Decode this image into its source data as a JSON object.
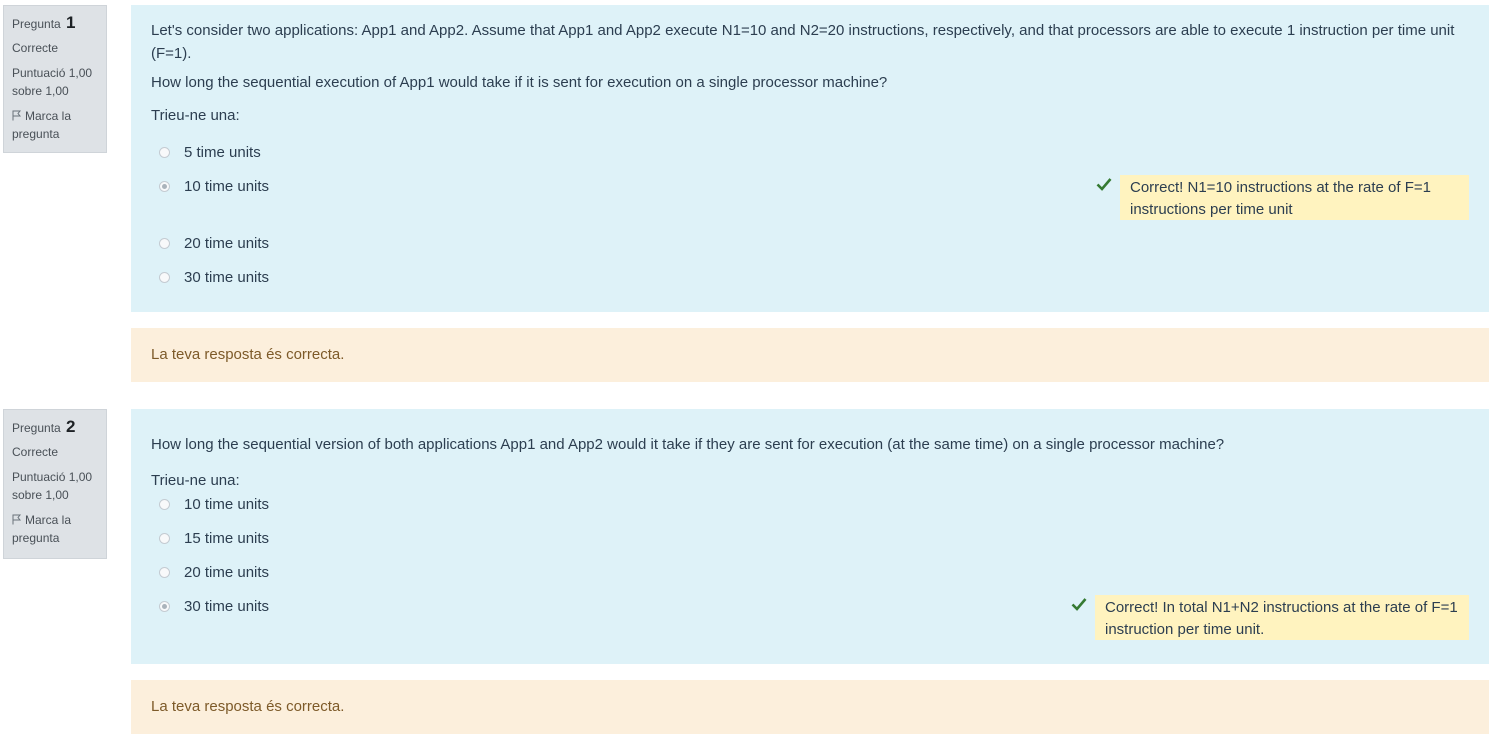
{
  "questions": [
    {
      "label": "Pregunta",
      "number": "1",
      "state": "Correcte",
      "grade_line1": "Puntuació 1,00",
      "grade_line2": "sobre 1,00",
      "flag_line1": "Marca la",
      "flag_line2": "pregunta",
      "text_p1": "Let's consider two applications: App1 and App2. Assume that App1 and App2 execute N1=10 and N2=20 instructions, respectively, and that processors are able to execute 1 instruction per time unit (F=1).",
      "text_p2": "How long the sequential execution of App1 would take if it is sent for execution on a single processor machine?",
      "prompt": "Trieu-ne una:",
      "options": [
        "5 time units",
        "10 time units",
        "20 time units",
        "30 time units"
      ],
      "selected_option": "10 time units",
      "feedback": "Correct! N1=10 instructions at the rate of F=1 instructions per time unit",
      "outcome": "La teva resposta és correcta."
    },
    {
      "label": "Pregunta",
      "number": "2",
      "state": "Correcte",
      "grade_line1": "Puntuació 1,00",
      "grade_line2": "sobre 1,00",
      "flag_line1": "Marca la",
      "flag_line2": "pregunta",
      "text_p1": "How long the sequential version of both applications App1 and App2 would it take if they are sent for execution (at the same time) on a single processor machine?",
      "prompt": "Trieu-ne una:",
      "options": [
        "10 time units",
        "15 time units",
        "20 time units",
        "30 time units"
      ],
      "selected_option": "30 time units",
      "feedback": "Correct! In total N1+N2 instructions at the rate of F=1 instruction per time unit.",
      "outcome": "La teva resposta és correcta."
    }
  ],
  "colors": {
    "formulation_bg": "#def2f8",
    "outcome_bg": "#fcefdc",
    "feedback_bg": "#fff3bf",
    "check_green": "#357a32",
    "info_bg": "#dee2e6"
  },
  "icons": [
    "flag-icon",
    "check-icon"
  ]
}
